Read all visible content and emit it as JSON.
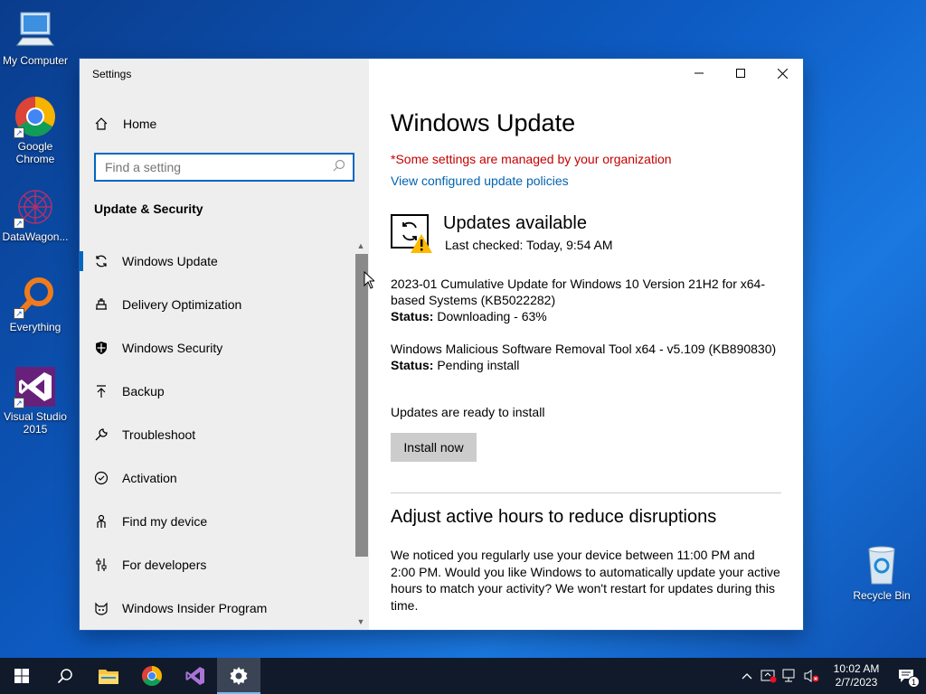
{
  "desktop": {
    "icons": [
      {
        "label": "My Computer"
      },
      {
        "label": "Google Chrome"
      },
      {
        "label": "DataWagon..."
      },
      {
        "label": "Everything"
      },
      {
        "label": "Visual Studio 2015"
      }
    ],
    "recycle_bin": {
      "label": "Recycle Bin"
    }
  },
  "window": {
    "title": "Settings",
    "controls": {
      "minimize": "minimize-icon",
      "maximize": "maximize-icon",
      "close": "close-icon"
    }
  },
  "sidebar": {
    "home_label": "Home",
    "search_placeholder": "Find a setting",
    "section_title": "Update & Security",
    "items": [
      {
        "label": "Windows Update",
        "icon": "sync-icon",
        "selected": true
      },
      {
        "label": "Delivery Optimization",
        "icon": "delivery-icon"
      },
      {
        "label": "Windows Security",
        "icon": "shield-icon"
      },
      {
        "label": "Backup",
        "icon": "backup-arrow-icon"
      },
      {
        "label": "Troubleshoot",
        "icon": "wrench-icon"
      },
      {
        "label": "Activation",
        "icon": "check-circle-icon"
      },
      {
        "label": "Find my device",
        "icon": "person-locate-icon"
      },
      {
        "label": "For developers",
        "icon": "developer-sliders-icon"
      },
      {
        "label": "Windows Insider Program",
        "icon": "insider-cat-icon"
      }
    ]
  },
  "main": {
    "title": "Windows Update",
    "org_note": "*Some settings are managed by your organization",
    "policy_link": "View configured update policies",
    "status": {
      "title": "Updates available",
      "last_checked": "Last checked: Today, 9:54 AM"
    },
    "updates": [
      {
        "name": "2023-01 Cumulative Update for Windows 10 Version 21H2 for x64-based Systems (KB5022282)",
        "status_label": "Status:",
        "status_value": "Downloading - 63%"
      },
      {
        "name": "Windows Malicious Software Removal Tool x64 - v5.109 (KB890830)",
        "status_label": "Status:",
        "status_value": "Pending install"
      }
    ],
    "ready_text": "Updates are ready to install",
    "install_button": "Install now",
    "active_hours_heading": "Adjust active hours to reduce disruptions",
    "active_hours_text": "We noticed you regularly use your device between 11:00 PM and 2:00 PM. Would you like Windows to automatically update your active hours to match your activity? We won't restart for updates during this time."
  },
  "taskbar": {
    "time": "10:02 AM",
    "date": "2/7/2023",
    "notification_count": "1",
    "apps": [
      "start-icon",
      "search-icon",
      "file-explorer-icon",
      "chrome-icon",
      "visual-studio-icon",
      "settings-gear-icon"
    ]
  },
  "colors": {
    "accent": "#0067c0",
    "warning_text": "#c50000",
    "link": "#0063b1"
  }
}
